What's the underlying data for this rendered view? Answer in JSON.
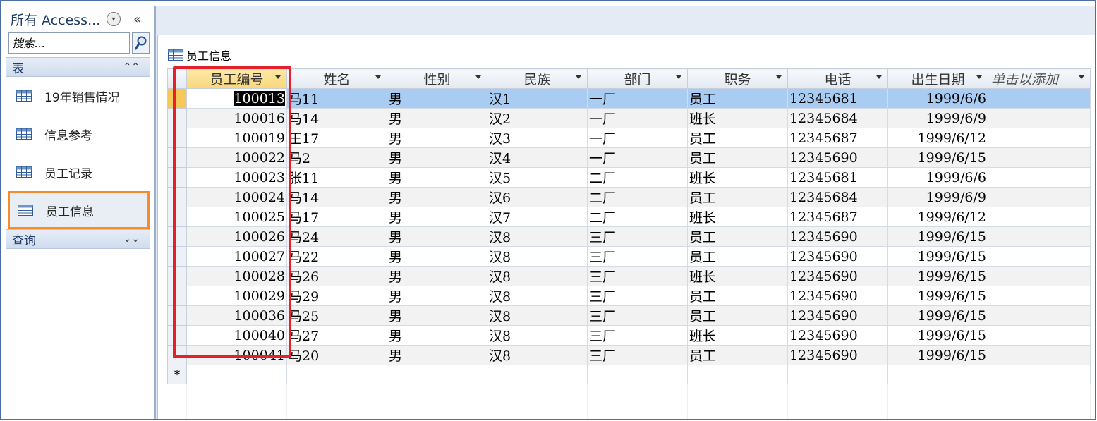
{
  "nav": {
    "title": "所有 Access...",
    "search_placeholder": "搜索...",
    "groups": [
      {
        "label": "表",
        "chevron": "⌃⌃"
      },
      {
        "label": "查询",
        "chevron": "⌄⌄"
      }
    ],
    "items": [
      {
        "label": "19年销售情况"
      },
      {
        "label": "信息参考"
      },
      {
        "label": "员工记录"
      },
      {
        "label": "员工信息"
      }
    ],
    "collapse_glyph": "«"
  },
  "tab": {
    "label": "员工信息"
  },
  "table": {
    "columns": [
      "员工编号",
      "姓名",
      "性别",
      "民族",
      "部门",
      "职务",
      "电话",
      "出生日期",
      "单击以添加"
    ],
    "rows": [
      [
        "100013",
        "马11",
        "男",
        "汉1",
        "一厂",
        "员工",
        "12345681",
        "1999/6/6"
      ],
      [
        "100016",
        "马14",
        "男",
        "汉2",
        "一厂",
        "班长",
        "12345684",
        "1999/6/9"
      ],
      [
        "100019",
        "王17",
        "男",
        "汉3",
        "一厂",
        "员工",
        "12345687",
        "1999/6/12"
      ],
      [
        "100022",
        "马2",
        "男",
        "汉4",
        "一厂",
        "员工",
        "12345690",
        "1999/6/15"
      ],
      [
        "100023",
        "张11",
        "男",
        "汉5",
        "二厂",
        "班长",
        "12345681",
        "1999/6/6"
      ],
      [
        "100024",
        "马14",
        "男",
        "汉6",
        "二厂",
        "员工",
        "12345684",
        "1999/6/9"
      ],
      [
        "100025",
        "马17",
        "男",
        "汉7",
        "二厂",
        "班长",
        "12345687",
        "1999/6/12"
      ],
      [
        "100026",
        "马24",
        "男",
        "汉8",
        "三厂",
        "员工",
        "12345690",
        "1999/6/15"
      ],
      [
        "100027",
        "马22",
        "男",
        "汉8",
        "三厂",
        "员工",
        "12345690",
        "1999/6/15"
      ],
      [
        "100028",
        "马26",
        "男",
        "汉8",
        "三厂",
        "班长",
        "12345690",
        "1999/6/15"
      ],
      [
        "100029",
        "马29",
        "男",
        "汉8",
        "三厂",
        "员工",
        "12345690",
        "1999/6/15"
      ],
      [
        "100036",
        "马25",
        "男",
        "汉8",
        "三厂",
        "员工",
        "12345690",
        "1999/6/15"
      ],
      [
        "100040",
        "马27",
        "男",
        "汉8",
        "三厂",
        "班长",
        "12345690",
        "1999/6/15"
      ],
      [
        "100041",
        "马20",
        "男",
        "汉8",
        "三厂",
        "员工",
        "12345690",
        "1999/6/15"
      ]
    ],
    "new_row_marker": "*"
  },
  "colors": {
    "highlight_red": "#e5202a",
    "highlight_orange": "#f68a2c",
    "current_row": "#a9cdf2"
  }
}
